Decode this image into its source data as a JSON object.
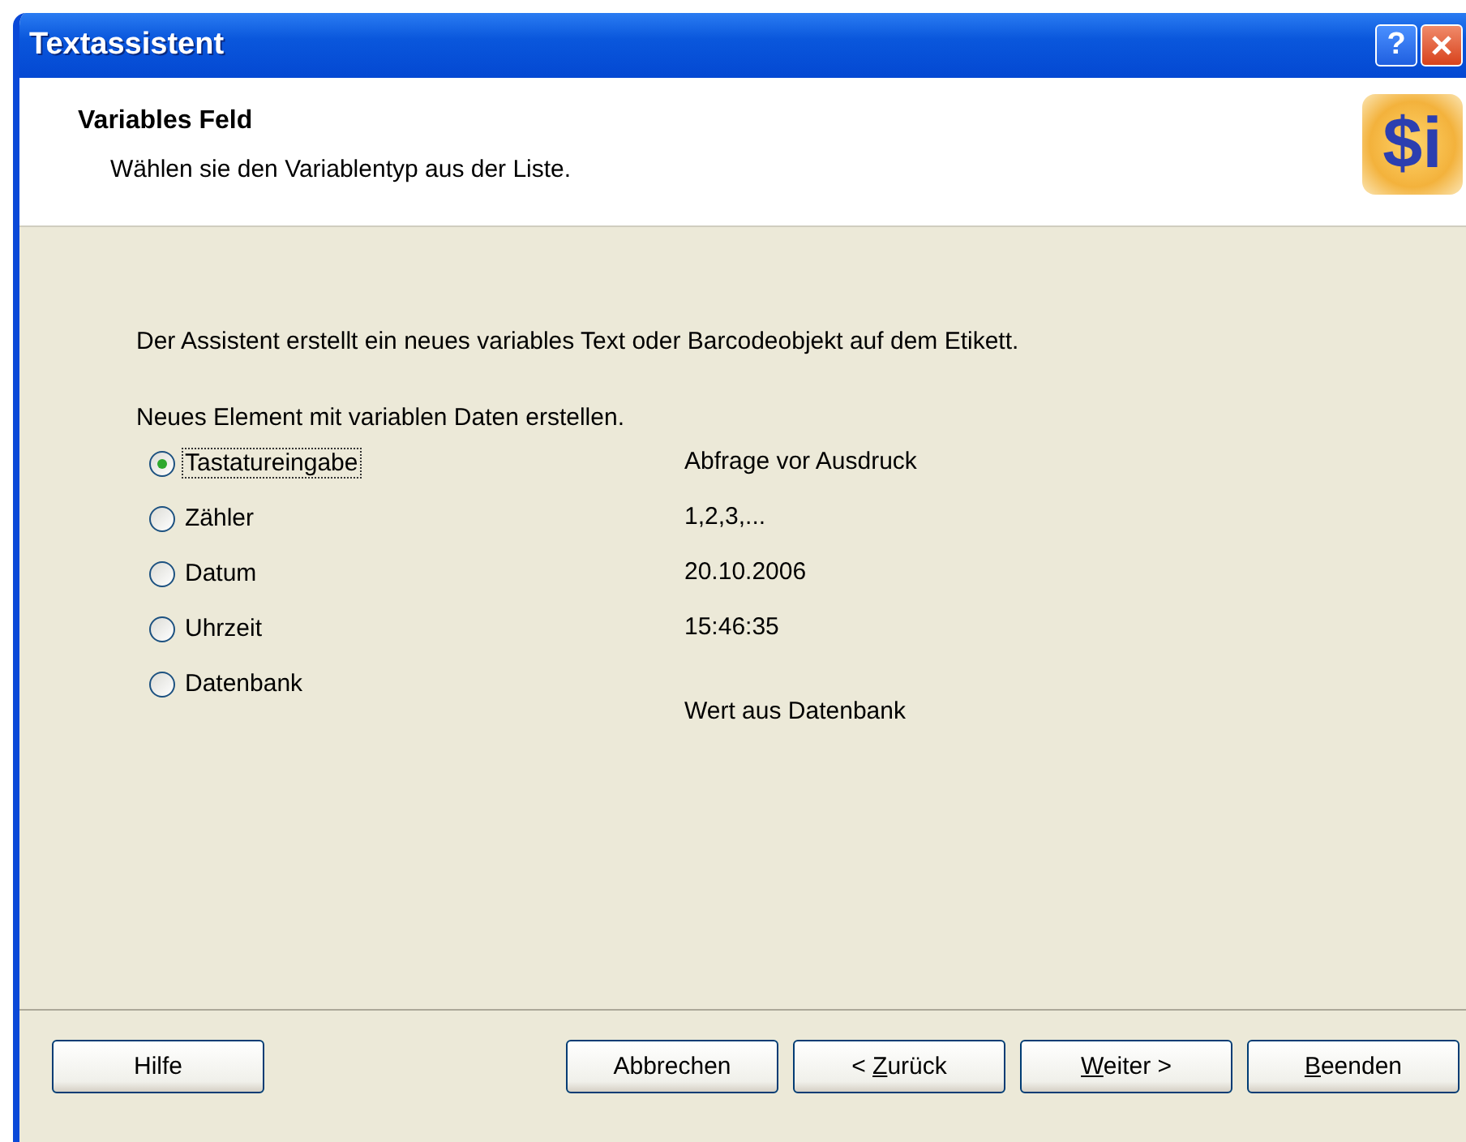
{
  "window": {
    "title": "Textassistent",
    "title_buttons": [
      {
        "kind": "help",
        "label": "?"
      },
      {
        "kind": "close"
      }
    ]
  },
  "header": {
    "title": "Variables Feld",
    "subtitle": "Wählen sie den Variablentyp aus der Liste.",
    "logo_text": "$i"
  },
  "intro": "Der Assistent erstellt ein neues variables Text oder Barcodeobjekt auf dem Etikett.",
  "prompt": "Neues Element mit variablen Daten erstellen.",
  "options": [
    {
      "label": "Tastatureingabe",
      "selected": true,
      "focused": true,
      "description": "Abfrage vor Ausdruck"
    },
    {
      "label": "Zähler",
      "selected": false,
      "focused": false,
      "description": "1,2,3,..."
    },
    {
      "label": "Datum",
      "selected": false,
      "focused": false,
      "description": "20.10.2006"
    },
    {
      "label": "Uhrzeit",
      "selected": false,
      "focused": false,
      "description": "15:46:35"
    },
    {
      "label": "Datenbank",
      "selected": false,
      "focused": false,
      "description": "Wert aus Datenbank"
    }
  ],
  "buttons": [
    {
      "kind": "help",
      "pre": "Hilfe"
    },
    {
      "kind": "nav",
      "pre": "Abbrechen"
    },
    {
      "kind": "nav",
      "pre": "< ",
      "key": "Z",
      "post": "urück"
    },
    {
      "kind": "nav",
      "key": "W",
      "post": "eiter >"
    },
    {
      "kind": "nav",
      "key": "B",
      "post": "eenden"
    }
  ]
}
